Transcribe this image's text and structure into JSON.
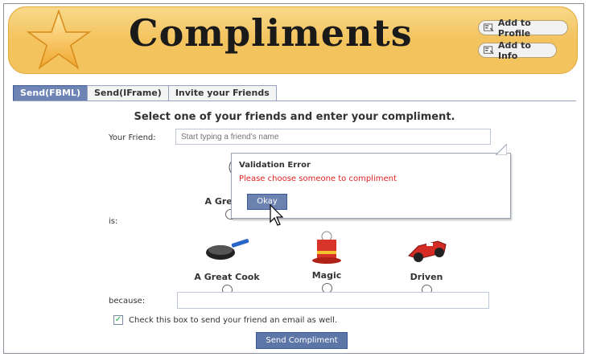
{
  "header": {
    "title": "Compliments",
    "add_to_profile": "Add to Profile",
    "add_to_info": "Add to Info"
  },
  "tabs": [
    {
      "label": "Send(FBML)",
      "active": true
    },
    {
      "label": "Send(IFrame)",
      "active": false
    },
    {
      "label": "Invite your Friends",
      "active": false
    }
  ],
  "form": {
    "heading": "Select one of your friends and enter your compliment.",
    "friend_label": "Your Friend:",
    "friend_placeholder": "Start typing a friend's name",
    "is_label": "is:",
    "because_label": "because:",
    "email_checkbox_label": "Check this box to send your friend an email as well.",
    "email_checked": true,
    "send_button": "Send Compliment"
  },
  "choices": [
    {
      "label": "A Great",
      "icon": "cute-character-icon"
    },
    {
      "label": "A Great Cook",
      "icon": "frying-pan-icon"
    },
    {
      "label": "Magic",
      "icon": "magic-hat-icon"
    },
    {
      "label": "Driven",
      "icon": "race-car-icon"
    }
  ],
  "validation": {
    "title": "Validation Error",
    "message": "Please choose someone to compliment",
    "ok_button": "Okay"
  },
  "colors": {
    "banner": "#f3c35e",
    "facebook_blue": "#3b5998",
    "error_red": "#dd2222"
  }
}
